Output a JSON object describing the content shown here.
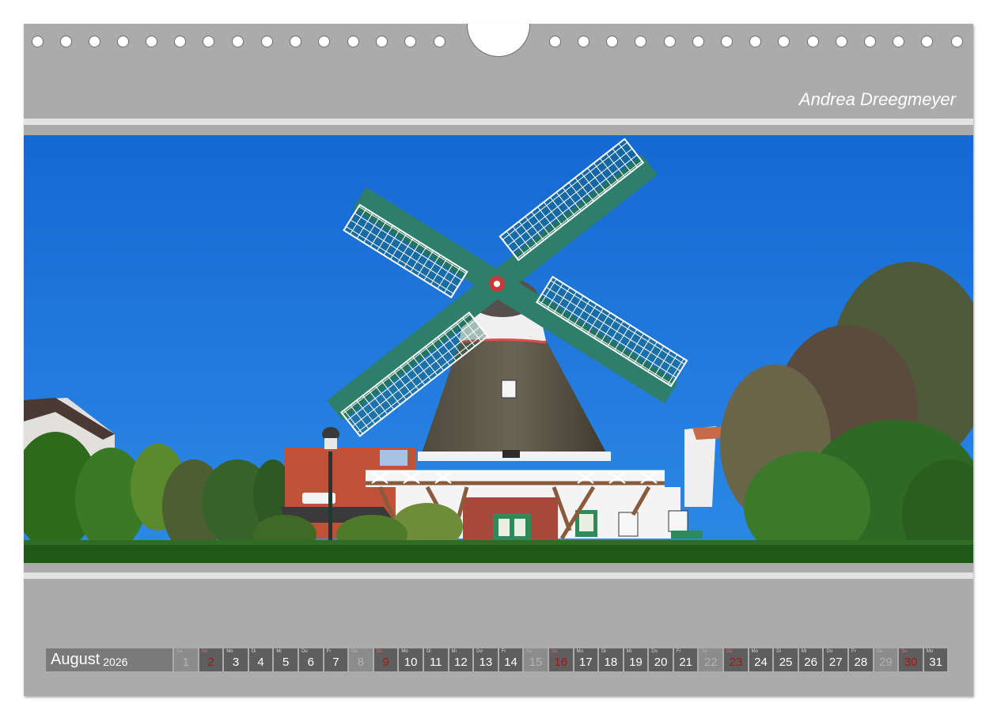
{
  "author": "Andrea Dreegmeyer",
  "calendar": {
    "month": "August",
    "year": "2026",
    "days": [
      {
        "d": "1",
        "w": "Sa",
        "t": "sat"
      },
      {
        "d": "2",
        "w": "So",
        "t": "sun"
      },
      {
        "d": "3",
        "w": "Mo",
        "t": ""
      },
      {
        "d": "4",
        "w": "Di",
        "t": ""
      },
      {
        "d": "5",
        "w": "Mi",
        "t": ""
      },
      {
        "d": "6",
        "w": "Do",
        "t": ""
      },
      {
        "d": "7",
        "w": "Fr",
        "t": ""
      },
      {
        "d": "8",
        "w": "Sa",
        "t": "sat"
      },
      {
        "d": "9",
        "w": "So",
        "t": "sun"
      },
      {
        "d": "10",
        "w": "Mo",
        "t": ""
      },
      {
        "d": "11",
        "w": "Di",
        "t": ""
      },
      {
        "d": "12",
        "w": "Mi",
        "t": ""
      },
      {
        "d": "13",
        "w": "Do",
        "t": ""
      },
      {
        "d": "14",
        "w": "Fr",
        "t": ""
      },
      {
        "d": "15",
        "w": "Sa",
        "t": "sat"
      },
      {
        "d": "16",
        "w": "So",
        "t": "sun"
      },
      {
        "d": "17",
        "w": "Mo",
        "t": ""
      },
      {
        "d": "18",
        "w": "Di",
        "t": ""
      },
      {
        "d": "19",
        "w": "Mi",
        "t": ""
      },
      {
        "d": "20",
        "w": "Do",
        "t": ""
      },
      {
        "d": "21",
        "w": "Fr",
        "t": ""
      },
      {
        "d": "22",
        "w": "Sa",
        "t": "sat"
      },
      {
        "d": "23",
        "w": "So",
        "t": "sun"
      },
      {
        "d": "24",
        "w": "Mo",
        "t": ""
      },
      {
        "d": "25",
        "w": "Di",
        "t": ""
      },
      {
        "d": "26",
        "w": "Mi",
        "t": ""
      },
      {
        "d": "27",
        "w": "Do",
        "t": ""
      },
      {
        "d": "28",
        "w": "Fr",
        "t": ""
      },
      {
        "d": "29",
        "w": "Sa",
        "t": "sat"
      },
      {
        "d": "30",
        "w": "So",
        "t": "sun"
      },
      {
        "d": "31",
        "w": "Mo",
        "t": ""
      }
    ]
  }
}
